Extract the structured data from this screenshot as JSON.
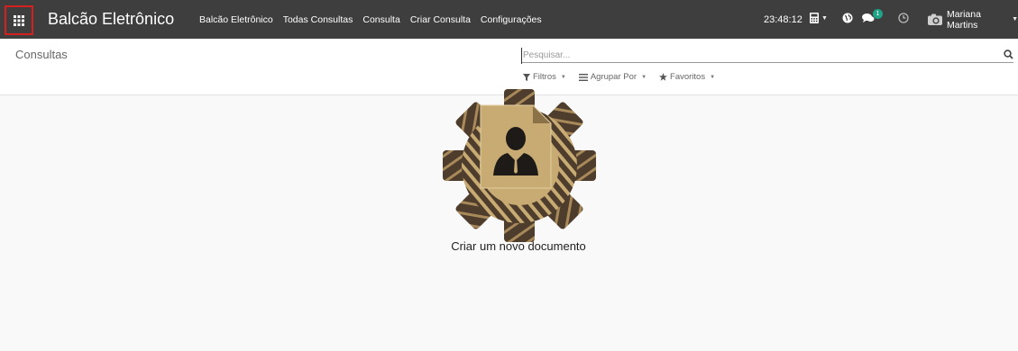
{
  "topbar": {
    "brand": "Balcão Eletrônico",
    "menu": [
      "Balcão Eletrônico",
      "Todas Consultas",
      "Consulta",
      "Criar Consulta",
      "Configurações"
    ],
    "clock": "23:48:12",
    "messages_badge": "1",
    "user_name": "Mariana Martins"
  },
  "control_panel": {
    "title": "Consultas",
    "search_placeholder": "Pesquisar...",
    "filters_label": "Filtros",
    "groupby_label": "Agrupar Por",
    "favorites_label": "Favoritos"
  },
  "content": {
    "help_text": "Criar um novo documento"
  },
  "colors": {
    "topbar_bg": "#3e3e3e",
    "apps_highlight": "#d62020",
    "badge": "#1fa387",
    "gear_dark": "#4e3c2c",
    "gear_light": "#c8ab73"
  },
  "icons": [
    "apps-grid-icon",
    "calculator-icon",
    "globe-icon",
    "chat-icon",
    "clock-icon",
    "camera-avatar-icon",
    "search-icon",
    "filter-icon",
    "list-icon",
    "star-icon"
  ]
}
